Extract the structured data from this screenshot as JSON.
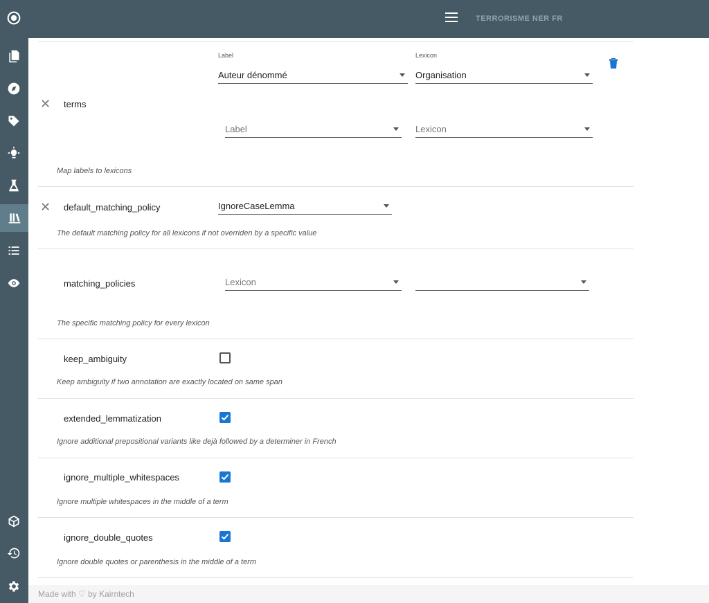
{
  "app": {
    "title": "TERRORISME NER FR"
  },
  "sidebar": {
    "items": [
      {
        "name": "logo-icon"
      },
      {
        "name": "documents-icon"
      },
      {
        "name": "compass-icon"
      },
      {
        "name": "tag-icon"
      },
      {
        "name": "lightbulb-icon"
      },
      {
        "name": "flask-icon"
      },
      {
        "name": "library-icon"
      },
      {
        "name": "list-icon"
      },
      {
        "name": "eye-icon"
      },
      {
        "name": "cube-icon"
      },
      {
        "name": "history-icon"
      },
      {
        "name": "settings-icon"
      }
    ]
  },
  "params": {
    "terms": {
      "name": "terms",
      "row1": {
        "label_caption": "Label",
        "label_value": "Auteur dénommé",
        "lexicon_caption": "Lexicon",
        "lexicon_value": "Organisation"
      },
      "row2": {
        "label_placeholder": "Label",
        "lexicon_placeholder": "Lexicon"
      },
      "description": "Map labels to lexicons"
    },
    "default_matching_policy": {
      "name": "default_matching_policy",
      "value": "IgnoreCaseLemma",
      "description": "The default matching policy for all lexicons if not overriden by a specific value"
    },
    "matching_policies": {
      "name": "matching_policies",
      "lexicon_placeholder": "Lexicon",
      "policy_value": "",
      "description": "The specific matching policy for every lexicon"
    },
    "keep_ambiguity": {
      "name": "keep_ambiguity",
      "checked": false,
      "description": "Keep ambiguity if two annotation are exactly located on same span"
    },
    "extended_lemmatization": {
      "name": "extended_lemmatization",
      "checked": true,
      "description": "Ignore additional prepositional variants like dejà followed by a determiner in French"
    },
    "ignore_multiple_whitespaces": {
      "name": "ignore_multiple_whitespaces",
      "checked": true,
      "description": "Ignore multiple whitespaces in the middle of a term"
    },
    "ignore_double_quotes": {
      "name": "ignore_double_quotes",
      "checked": true,
      "description": "Ignore double quotes or parenthesis in the middle of a term"
    }
  },
  "footer": {
    "text": "Made with ♡ by Kairntech"
  },
  "colors": {
    "sidebar": "#455a64",
    "accent": "#1976d2"
  }
}
